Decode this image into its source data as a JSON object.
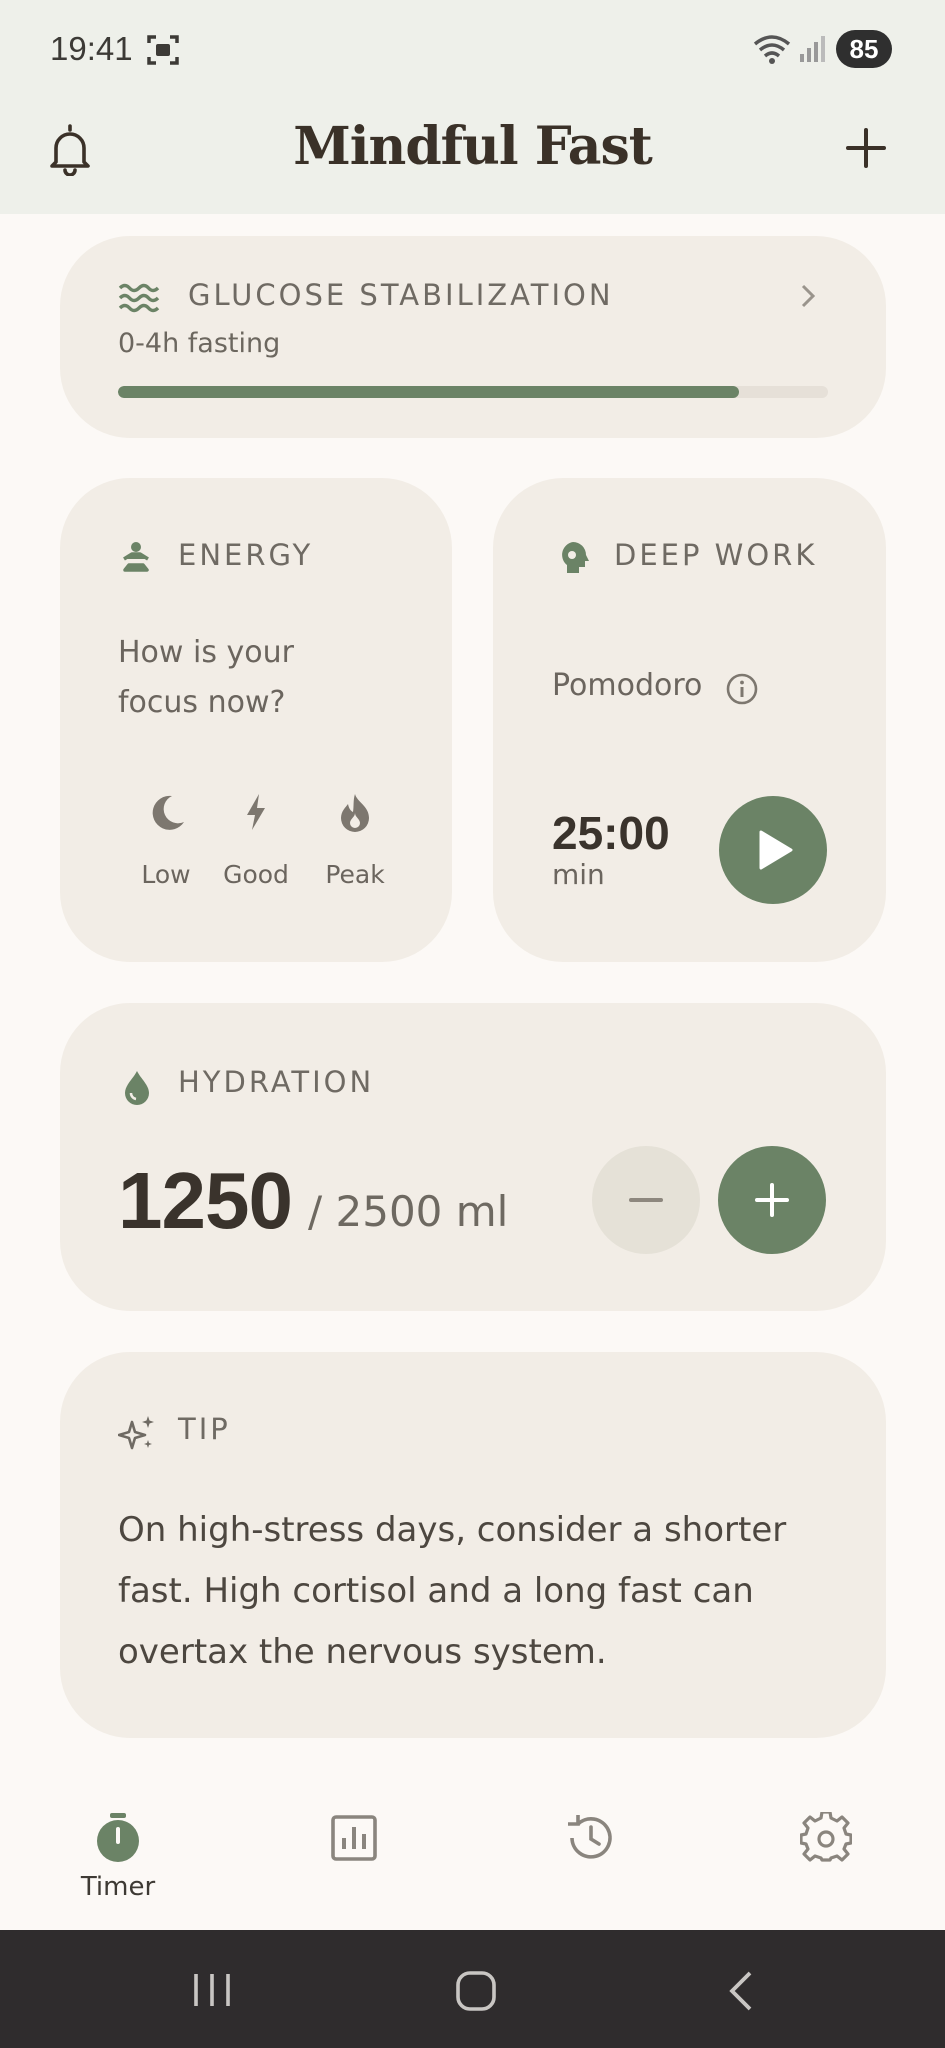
{
  "status_bar": {
    "time": "19:41",
    "battery": "85",
    "icons": [
      "screen-record-icon",
      "wifi-icon",
      "signal-icon",
      "battery-icon"
    ]
  },
  "app_bar": {
    "title": "Mindful Fast",
    "left_icon": "bell-icon",
    "right_icon": "plus-icon"
  },
  "glucose": {
    "label": "GLUCOSE STABILIZATION",
    "subtitle": "0-4h fasting",
    "progress": 0.875,
    "icon": "waves-icon"
  },
  "energy": {
    "label": "ENERGY",
    "question": "How is your focus now?",
    "options": [
      {
        "label": "Low",
        "icon": "moon-icon"
      },
      {
        "label": "Good",
        "icon": "bolt-icon"
      },
      {
        "label": "Peak",
        "icon": "flame-icon"
      }
    ]
  },
  "deep_work": {
    "label": "DEEP WORK",
    "mode": "Pomodoro",
    "time": "25:00",
    "unit": "min"
  },
  "hydration": {
    "label": "HYDRATION",
    "value": "1250",
    "goal": "/ 2500 ml"
  },
  "tip": {
    "label": "TIP",
    "text": "On high-stress days, consider a shorter fast. High cortisol and a long fast can overtax the nervous system."
  },
  "bottom_nav": {
    "items": [
      {
        "label": "Timer",
        "icon": "stopwatch-icon",
        "active": true
      },
      {
        "label": "",
        "icon": "bar-chart-icon",
        "active": false
      },
      {
        "label": "",
        "icon": "history-icon",
        "active": false
      },
      {
        "label": "",
        "icon": "gear-icon",
        "active": false
      }
    ]
  },
  "colors": {
    "accent": "#6b8366",
    "card": "#f2ede6",
    "background": "#fcf9f6",
    "header": "#eef0ea"
  }
}
